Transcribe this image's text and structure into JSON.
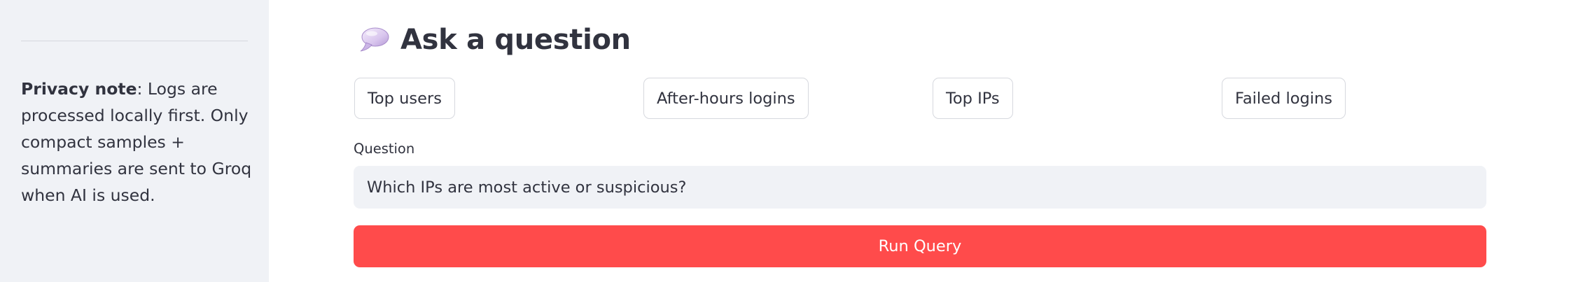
{
  "sidebar": {
    "privacy_note": {
      "label": "Privacy note",
      "separator": ":",
      "text": " Logs are processed locally first. Only compact samples + summaries are sent to Groq when AI is used."
    }
  },
  "main": {
    "heading": {
      "icon": "speech-balloon-icon",
      "title": "Ask a question"
    },
    "quick_queries": [
      {
        "label": "Top users"
      },
      {
        "label": "After-hours logins"
      },
      {
        "label": "Top IPs"
      },
      {
        "label": "Failed logins"
      }
    ],
    "question": {
      "label": "Question",
      "value": "Which IPs are most active or suspicious?"
    },
    "run_button": {
      "label": "Run Query"
    }
  },
  "colors": {
    "sidebar_bg": "#f0f2f6",
    "primary": "#ff4b4b",
    "text": "#31333f",
    "input_bg": "#f0f2f6",
    "border": "#d6d8de"
  }
}
